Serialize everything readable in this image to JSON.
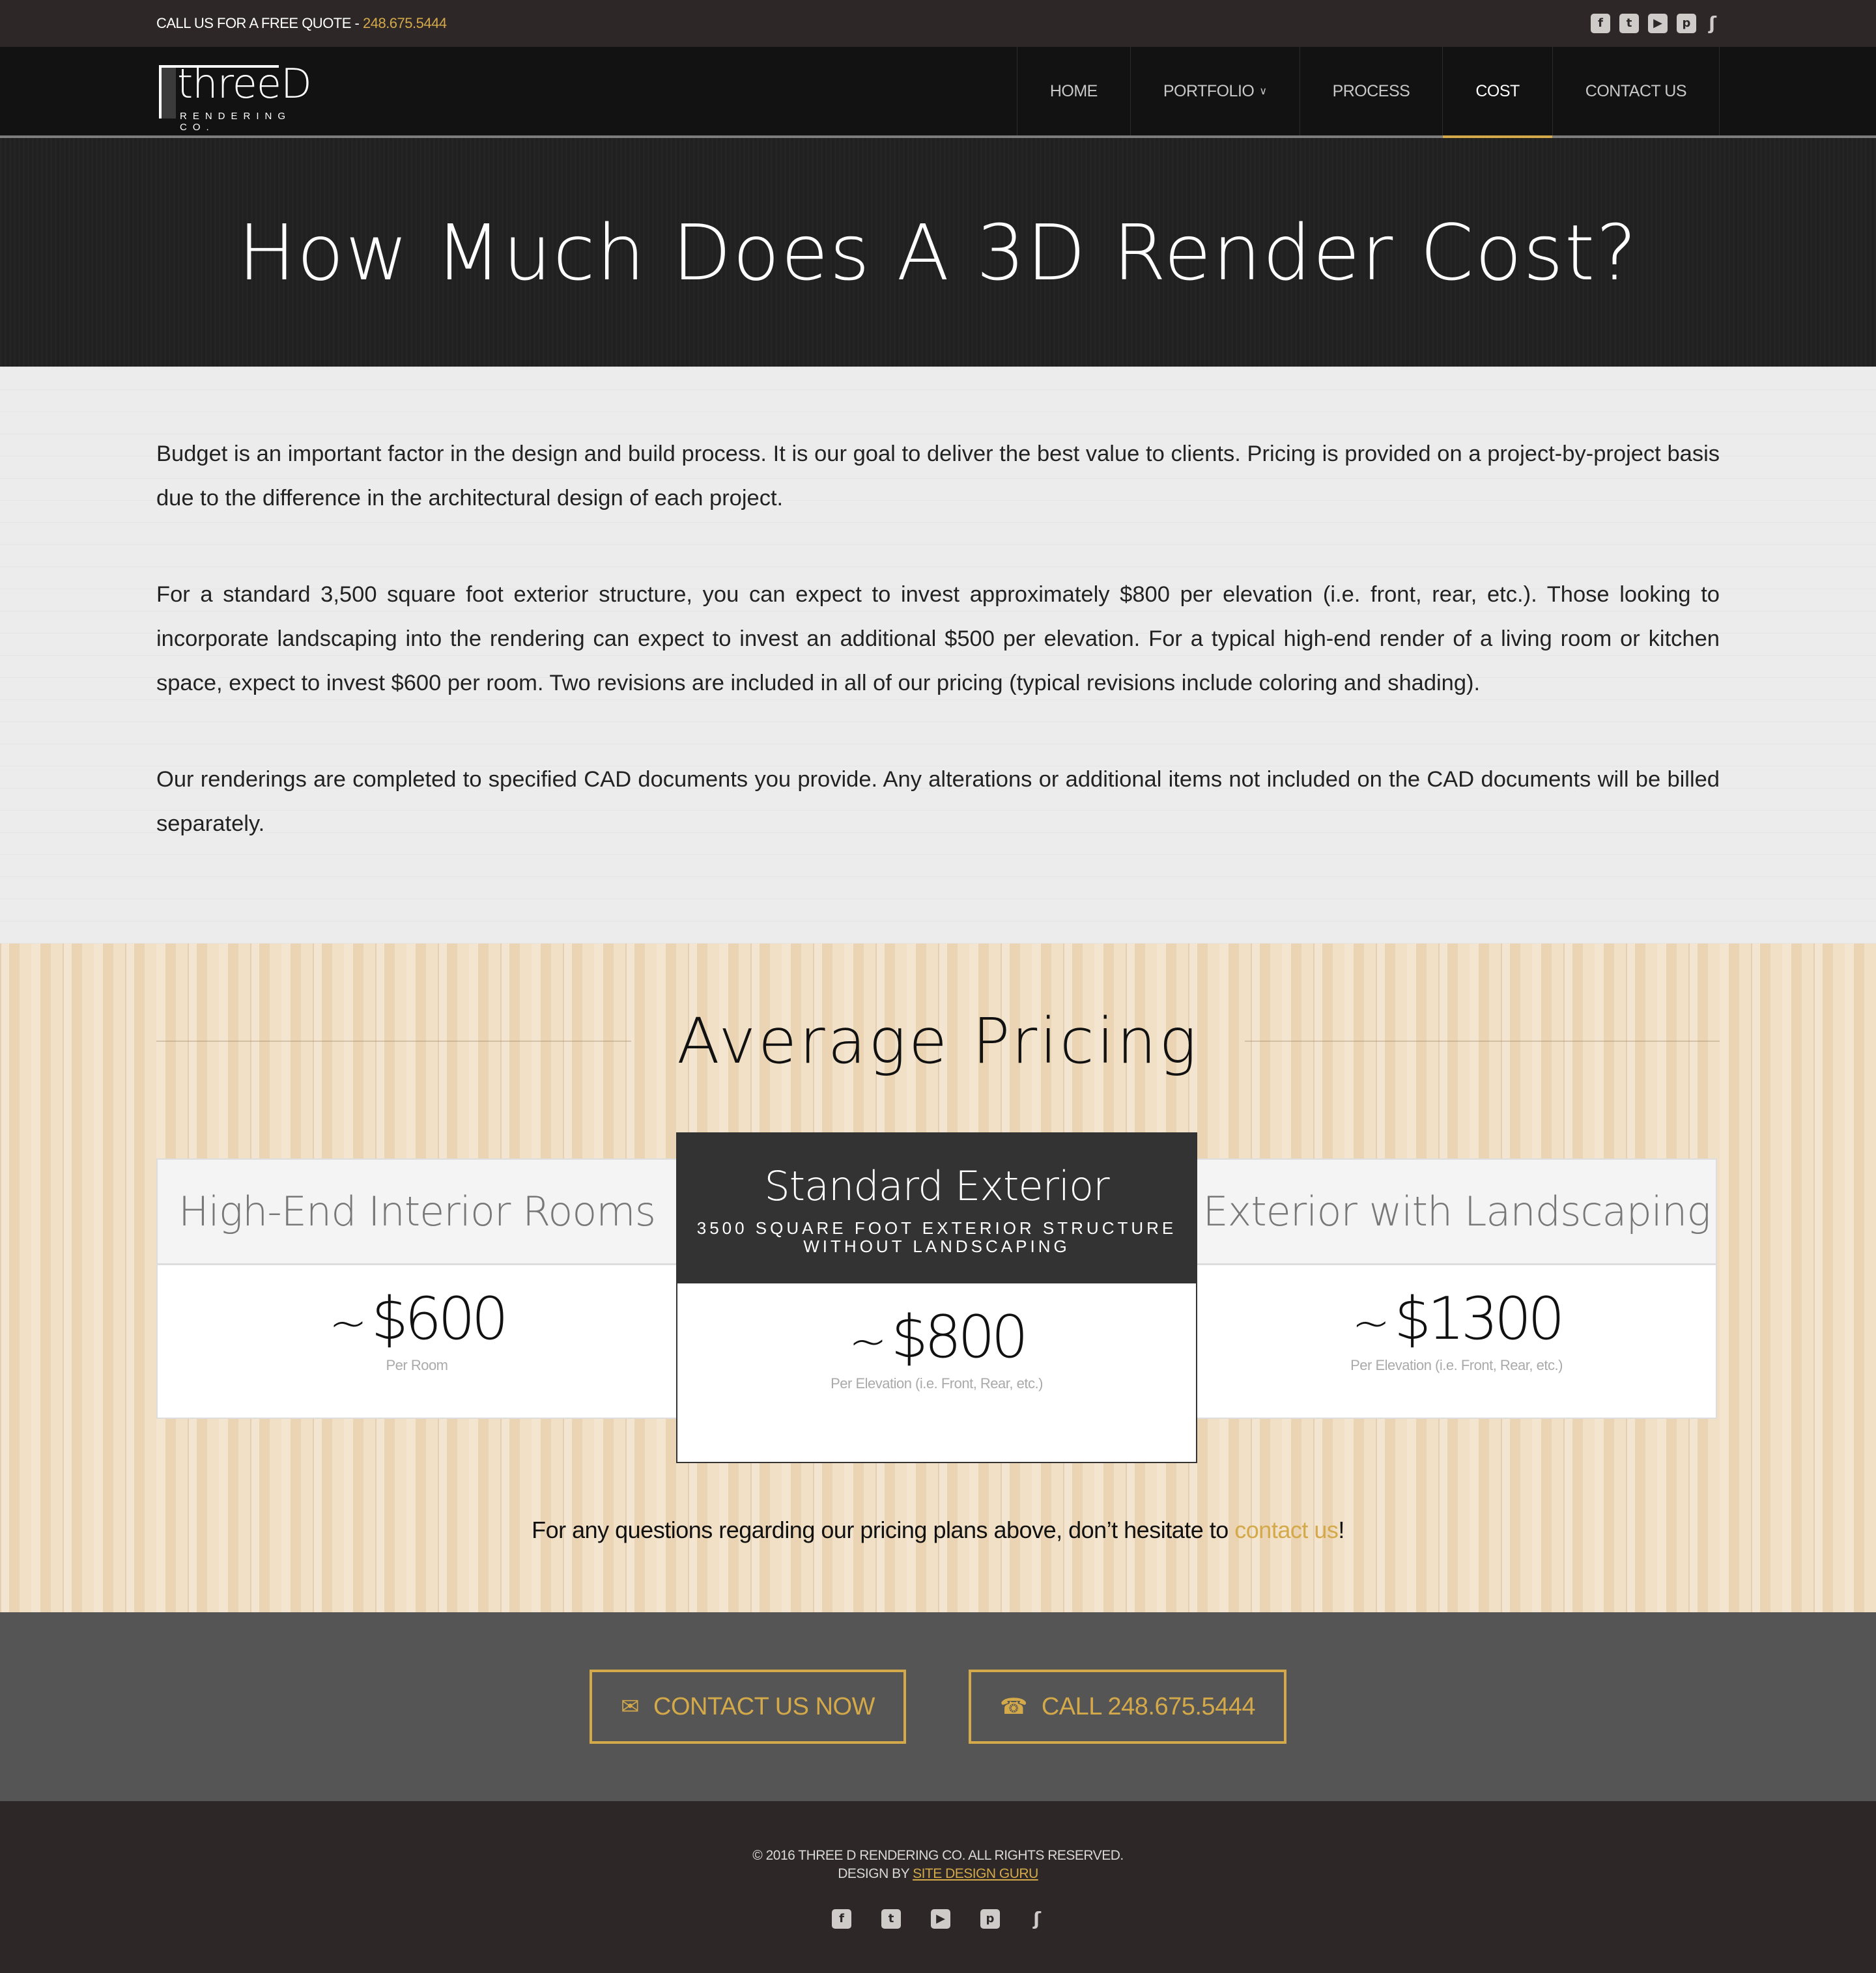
{
  "topbar": {
    "quote_label": "CALL US FOR A FREE QUOTE - ",
    "phone": "248.675.5444",
    "social": [
      {
        "name": "facebook",
        "glyph": "f"
      },
      {
        "name": "twitter",
        "glyph": "t"
      },
      {
        "name": "youtube",
        "glyph": "▶"
      },
      {
        "name": "pinterest",
        "glyph": "p"
      },
      {
        "name": "houzz",
        "glyph": "ʃ"
      }
    ]
  },
  "logo": {
    "word": "threeD",
    "sub": "RENDERING CO."
  },
  "nav": {
    "items": [
      {
        "label": "HOME",
        "active": false
      },
      {
        "label": "PORTFOLIO",
        "active": false,
        "caret": "»"
      },
      {
        "label": "PROCESS",
        "active": false
      },
      {
        "label": "COST",
        "active": true
      },
      {
        "label": "CONTACT US",
        "active": false
      }
    ]
  },
  "hero": {
    "title": "How Much Does A 3D Render Cost?"
  },
  "intro": {
    "paragraphs": [
      "Budget is an important factor in the design and build process.  It is our goal to deliver the best value to clients.  Pricing is provided on a project-by-project basis due to the difference in the architectural design of each project.",
      "For a standard 3,500 square foot exterior structure, you can expect to invest approximately $800 per elevation (i.e. front, rear, etc.).  Those looking to incorporate landscaping into the rendering can expect to invest an additional $500 per elevation.  For a typical high-end render of a living room or kitchen space, expect to invest $600 per room.  Two revisions are included in all of our pricing (typical revisions include coloring and shading).",
      "Our renderings are completed to specified CAD documents you provide.  Any alterations or additional items not included on the CAD documents will be billed separately."
    ]
  },
  "pricing": {
    "title": "Average Pricing",
    "cards": [
      {
        "title": "High-End Interior Rooms",
        "tilde": "~",
        "price": "$600",
        "unit": "Per Room"
      },
      {
        "title": "Standard Exterior",
        "subtitle_line1": "3500 SQUARE FOOT EXTERIOR STRUCTURE",
        "subtitle_line2": "WITHOUT LANDSCAPING",
        "tilde": "~",
        "price": "$800",
        "unit": "Per Elevation (i.e. Front, Rear, etc.)",
        "featured": true
      },
      {
        "title": "Exterior with Landscaping",
        "tilde": "~",
        "price": "$1300",
        "unit": "Per Elevation (i.e. Front, Rear, etc.)"
      }
    ],
    "note_prefix": "For any questions regarding our pricing plans above, don’t hesitate to ",
    "note_link": "contact us",
    "note_suffix": "!"
  },
  "cta": {
    "contact_icon": "✉",
    "contact_label": "CONTACT US NOW",
    "call_icon": "☎",
    "call_label": "CALL 248.675.5444"
  },
  "footer": {
    "copyright": "© 2016 THREE D RENDERING CO. ALL RIGHTS RESERVED.",
    "design_by": "DESIGN BY ",
    "designer": "SITE DESIGN GURU"
  },
  "colors": {
    "accent": "#d4a94a",
    "topbar_bg": "#2d2727",
    "nav_bg": "#121212",
    "cta_bg": "#555555",
    "featured_header": "#333333"
  }
}
